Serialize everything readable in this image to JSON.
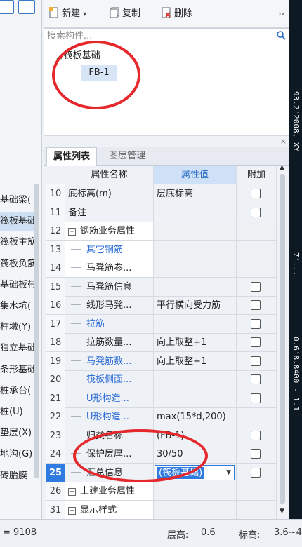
{
  "toolbar": {
    "new_label": "新建",
    "copy_label": "复制",
    "delete_label": "删除",
    "more_icon": "double-chevron-right"
  },
  "search": {
    "placeholder": "搜索构件..."
  },
  "tree": {
    "root": "筏板基础",
    "child": "FB-1"
  },
  "tabs": [
    "属性列表",
    "图层管理"
  ],
  "table": {
    "headers": [
      "",
      "属性名称",
      "属性值",
      "附加"
    ],
    "rows": [
      {
        "num": "10",
        "name": "底标高(m)",
        "value": "层底标高",
        "check": true,
        "style": "plain"
      },
      {
        "num": "11",
        "name": "备注",
        "value": "",
        "check": true,
        "style": "plain"
      },
      {
        "num": "12",
        "name": "钢筋业务属性",
        "value": "",
        "check": false,
        "style": "group",
        "expander": "−"
      },
      {
        "num": "13",
        "name": "其它钢筋",
        "value": "",
        "check": false,
        "style": "child-blue"
      },
      {
        "num": "14",
        "name": "马凳筋参...",
        "value": "",
        "check": false,
        "style": "child"
      },
      {
        "num": "15",
        "name": "马凳筋信息",
        "value": "",
        "check": true,
        "style": "child"
      },
      {
        "num": "16",
        "name": "线形马凳...",
        "value": "平行横向受力筋",
        "check": true,
        "style": "child"
      },
      {
        "num": "17",
        "name": "拉筋",
        "value": "",
        "check": true,
        "style": "child-blue"
      },
      {
        "num": "18",
        "name": "拉筋数量...",
        "value": "向上取整+1",
        "check": true,
        "style": "child"
      },
      {
        "num": "19",
        "name": "马凳筋数...",
        "value": "向上取整+1",
        "check": true,
        "style": "child-blue"
      },
      {
        "num": "20",
        "name": "筏板侧面...",
        "value": "",
        "check": true,
        "style": "child-blue"
      },
      {
        "num": "21",
        "name": "U形构造...",
        "value": "",
        "check": true,
        "style": "child-blue"
      },
      {
        "num": "22",
        "name": "U形构造...",
        "value": "max(15*d,200)",
        "check": false,
        "style": "child-blue"
      },
      {
        "num": "23",
        "name": "归类名称",
        "value": "(FB-1)",
        "check": true,
        "style": "child"
      },
      {
        "num": "24",
        "name": "保护层厚...",
        "value": "30/50",
        "check": true,
        "style": "child"
      },
      {
        "num": "25",
        "name": "汇总信息",
        "value": "(筏板基础)",
        "check": true,
        "style": "active"
      },
      {
        "num": "26",
        "name": "土建业务属性",
        "value": "",
        "check": false,
        "style": "group",
        "expander": "+"
      },
      {
        "num": "31",
        "name": "显示样式",
        "value": "",
        "check": false,
        "style": "group",
        "expander": "+"
      }
    ]
  },
  "left_nav": [
    {
      "label": "基础梁(",
      "selected": false
    },
    {
      "label": "筏板基础",
      "selected": true
    },
    {
      "label": "筏板主筋",
      "selected": false
    },
    {
      "label": "筏板负筋",
      "selected": false
    },
    {
      "label": "基础板带",
      "selected": false
    },
    {
      "label": "集水坑(",
      "selected": false
    },
    {
      "label": "柱墩(Y)",
      "selected": false
    },
    {
      "label": "独立基础",
      "selected": false
    },
    {
      "label": "条形基础",
      "selected": false
    },
    {
      "label": "桩承台(",
      "selected": false
    },
    {
      "label": "桩(U)",
      "selected": false
    },
    {
      "label": "垫层(X)",
      "selected": false
    },
    {
      "label": "地沟(G)",
      "selected": false
    },
    {
      "label": "砖胎膜",
      "selected": false
    }
  ],
  "status": {
    "left": "= 9108",
    "floor_height_label": "层高:",
    "floor_height_value": "0.6",
    "elev_label": "标高:",
    "elev_value": "3.6~4"
  },
  "right_strip": {
    "text_top": "93.2'2008, XY",
    "text_mid": "7'...",
    "text_bottom": "0.6'8.8400 - 1.1"
  },
  "colors": {
    "accent": "#2f7be0",
    "annotation": "#e5282b",
    "link_blue": "#2a6bd6"
  }
}
